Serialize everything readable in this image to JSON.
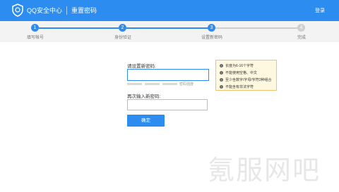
{
  "header": {
    "brand": "QQ安全中心",
    "subtitle": "重置密码",
    "login": "登录",
    "color": "#2d8cf0"
  },
  "steps": [
    {
      "number": "1",
      "label": "填写帐号",
      "state": "done"
    },
    {
      "number": "2",
      "label": "身份验证",
      "state": "done"
    },
    {
      "number": "3",
      "label": "设置新密码",
      "state": "current"
    },
    {
      "number": "4",
      "label": "完成",
      "state": "todo"
    }
  ],
  "form": {
    "new_password_label": "请设置新密码:",
    "new_password_value": "",
    "strength_text": "密码强度",
    "confirm_label": "再次输入新密码:",
    "confirm_value": "",
    "submit": "确定"
  },
  "tips": [
    {
      "icon": "info-icon",
      "text": "长度为6-16个字符"
    },
    {
      "icon": "info-icon",
      "text": "不能使用空格、中文"
    },
    {
      "icon": "info-icon",
      "text": "至少含数字/字母/字符2种组合"
    },
    {
      "icon": "info-icon",
      "text": "不能含有非法字符"
    }
  ],
  "watermark": "氪服网吧"
}
